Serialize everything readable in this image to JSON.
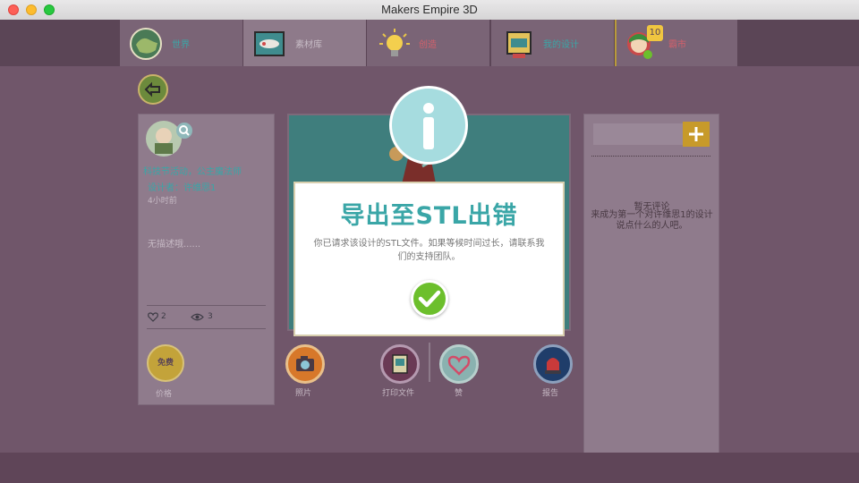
{
  "window": {
    "title": "Makers Empire 3D"
  },
  "nav": {
    "tabs": [
      {
        "label": "世界"
      },
      {
        "label": "素材库"
      },
      {
        "label": "创造"
      },
      {
        "label": "我的设计"
      },
      {
        "label": "霸市",
        "badge": "10"
      }
    ]
  },
  "design_panel": {
    "title": "科技节活动，公主魔法师",
    "designer": "设计者：许维思1",
    "time": "4小时前",
    "description": "无描述哦......",
    "likes": "2",
    "views": "3",
    "price_badge": "免费",
    "price_label": "价格"
  },
  "actions": {
    "photo_label": "照片",
    "print_label": "打印文件",
    "like_label": "赞",
    "report_label": "报告"
  },
  "comments": {
    "empty_title": "暂无评论",
    "empty_text": "来成为第一个对许维思1的设计说点什么的人吧。",
    "placeholder": ""
  },
  "modal": {
    "title": "导出至STL出错",
    "message": "你已请求该设计的STL文件。如果等候时间过长，请联系我们的支持团队。",
    "ok_icon": "checkmark-icon"
  },
  "colors": {
    "accent": "#3aa6a7",
    "modal_border": "#d8cfae",
    "ok_green": "#6cbf2c",
    "add_yellow": "#f7b500",
    "background": "#70566a"
  }
}
